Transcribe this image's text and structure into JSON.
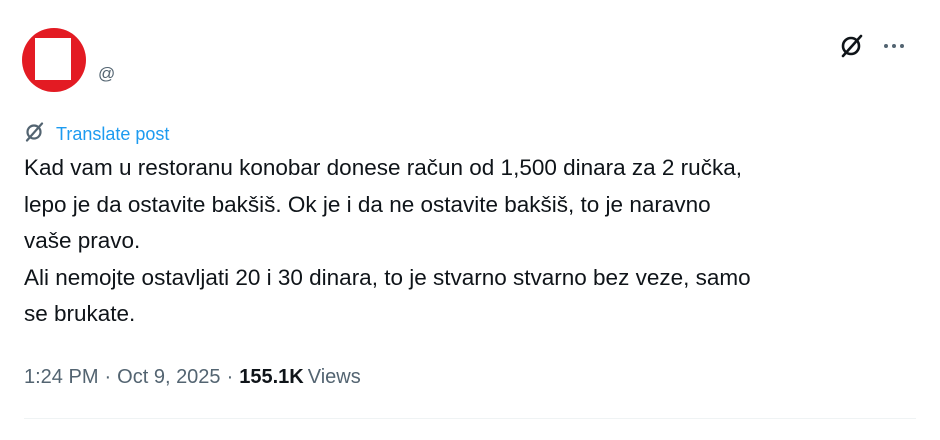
{
  "post": {
    "author": {
      "handle": "@"
    },
    "translate_label": "Translate post",
    "text_lines": [
      "Kad vam u restoranu konobar donese račun od 1,500 dinara za 2 ručka,",
      "lepo je da ostavite bakšiš. Ok je i da ne ostavite bakšiš, to je naravno",
      "vaše pravo.",
      "Ali nemojte ostavljati 20 i 30 dinara, to je stvarno stvarno bez veze, samo",
      "se brukate."
    ],
    "time": "1:24 PM",
    "separator": "·",
    "date": "Oct 9, 2025",
    "views_count": "155.1K",
    "views_label": "Views"
  },
  "icons": {
    "grok": "grok-icon",
    "more": "more-dots-icon",
    "translate": "translate-globe-icon"
  },
  "colors": {
    "text": "#0f1419",
    "secondary": "#536471",
    "link": "#1d9bf0",
    "avatar": "#e31b23"
  }
}
